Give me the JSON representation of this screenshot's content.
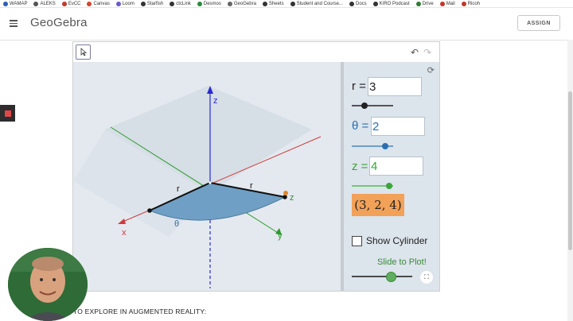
{
  "bookmarks": [
    {
      "label": "WAMAP",
      "color": "#2b5fb5"
    },
    {
      "label": "ALEKS",
      "color": "#555"
    },
    {
      "label": "EvCC",
      "color": "#c0392b"
    },
    {
      "label": "Canvas",
      "color": "#d2462b"
    },
    {
      "label": "Loom",
      "color": "#6a5acd"
    },
    {
      "label": "Starfish",
      "color": "#333"
    },
    {
      "label": "ctcLink",
      "color": "#333"
    },
    {
      "label": "Desmos",
      "color": "#2b8a3e"
    },
    {
      "label": "GeoGebra",
      "color": "#666"
    },
    {
      "label": "Sheets",
      "color": "#333"
    },
    {
      "label": "Student and Course...",
      "color": "#333"
    },
    {
      "label": "Docs",
      "color": "#333"
    },
    {
      "label": "KIRO Podcast",
      "color": "#333"
    },
    {
      "label": "Drive",
      "color": "#2e7d32"
    },
    {
      "label": "Mail",
      "color": "#c0392b"
    },
    {
      "label": "Ricoh",
      "color": "#c0392b"
    }
  ],
  "header": {
    "logo": "GeoGebra",
    "assign": "ASSIGN"
  },
  "applet": {
    "r": {
      "label": "r =",
      "value": "3",
      "slider_fraction": 0.3,
      "color": "#222222"
    },
    "theta": {
      "label": "θ =",
      "value": "2",
      "slider_fraction": 0.8,
      "color": "#2d6fb0"
    },
    "z": {
      "label": "z =",
      "value": "4",
      "slider_fraction": 0.9,
      "color": "#3aa63a"
    },
    "result": "(3, 2, 4)",
    "show_cylinder": "Show Cylinder",
    "slide_to_plot": "Slide to Plot!",
    "play_slider_fraction": 0.65,
    "axes": {
      "z": "z",
      "x": "x",
      "y": "y"
    },
    "scene_labels": {
      "r1": "r",
      "r2": "r",
      "theta": "θ",
      "point_z": "z"
    }
  },
  "bottom_text": "TO EXPLORE IN AUGMENTED REALITY:"
}
